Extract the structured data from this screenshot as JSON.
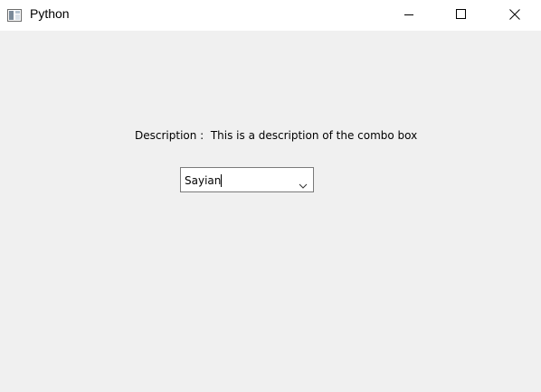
{
  "window": {
    "title": "Python",
    "icon": "python-app-icon",
    "controls": [
      "minimize-icon",
      "maximize-icon",
      "close-icon"
    ]
  },
  "form": {
    "description": "Description :  This is a description of the combo box",
    "combo_value": "Sayian"
  }
}
